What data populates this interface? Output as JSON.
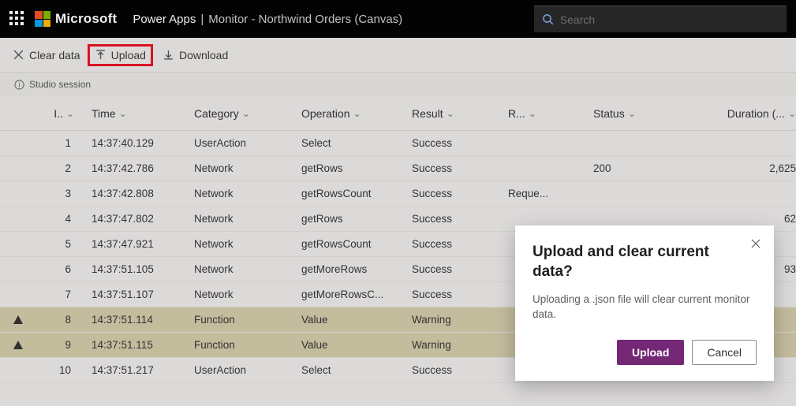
{
  "header": {
    "brand": "Microsoft",
    "app": "Power Apps",
    "sep": "|",
    "page": "Monitor - Northwind Orders (Canvas)",
    "search_placeholder": "Search"
  },
  "commands": {
    "clear": "Clear data",
    "upload": "Upload",
    "download": "Download"
  },
  "session": {
    "label": "Studio session"
  },
  "table": {
    "columns": [
      "I..",
      "Time",
      "Category",
      "Operation",
      "Result",
      "R...",
      "Status",
      "Duration (..."
    ],
    "rows": [
      {
        "warn": false,
        "id": "1",
        "time": "14:37:40.129",
        "cat": "UserAction",
        "op": "Select",
        "res": "Success",
        "r": "",
        "status": "",
        "dur": ""
      },
      {
        "warn": false,
        "id": "2",
        "time": "14:37:42.786",
        "cat": "Network",
        "op": "getRows",
        "res": "Success",
        "r": "",
        "status": "200",
        "dur": "2,625"
      },
      {
        "warn": false,
        "id": "3",
        "time": "14:37:42.808",
        "cat": "Network",
        "op": "getRowsCount",
        "res": "Success",
        "r": "Reque...",
        "status": "",
        "dur": ""
      },
      {
        "warn": false,
        "id": "4",
        "time": "14:37:47.802",
        "cat": "Network",
        "op": "getRows",
        "res": "Success",
        "r": "",
        "status": "",
        "dur": "62"
      },
      {
        "warn": false,
        "id": "5",
        "time": "14:37:47.921",
        "cat": "Network",
        "op": "getRowsCount",
        "res": "Success",
        "r": "",
        "status": "",
        "dur": ""
      },
      {
        "warn": false,
        "id": "6",
        "time": "14:37:51.105",
        "cat": "Network",
        "op": "getMoreRows",
        "res": "Success",
        "r": "",
        "status": "",
        "dur": "93"
      },
      {
        "warn": false,
        "id": "7",
        "time": "14:37:51.107",
        "cat": "Network",
        "op": "getMoreRowsC...",
        "res": "Success",
        "r": "",
        "status": "",
        "dur": ""
      },
      {
        "warn": true,
        "id": "8",
        "time": "14:37:51.114",
        "cat": "Function",
        "op": "Value",
        "res": "Warning",
        "r": "",
        "status": "",
        "dur": ""
      },
      {
        "warn": true,
        "id": "9",
        "time": "14:37:51.115",
        "cat": "Function",
        "op": "Value",
        "res": "Warning",
        "r": "",
        "status": "",
        "dur": ""
      },
      {
        "warn": false,
        "id": "10",
        "time": "14:37:51.217",
        "cat": "UserAction",
        "op": "Select",
        "res": "Success",
        "r": "",
        "status": "",
        "dur": ""
      }
    ]
  },
  "dialog": {
    "title": "Upload and clear current data?",
    "body": "Uploading a .json file will clear current monitor data.",
    "primary": "Upload",
    "secondary": "Cancel"
  }
}
